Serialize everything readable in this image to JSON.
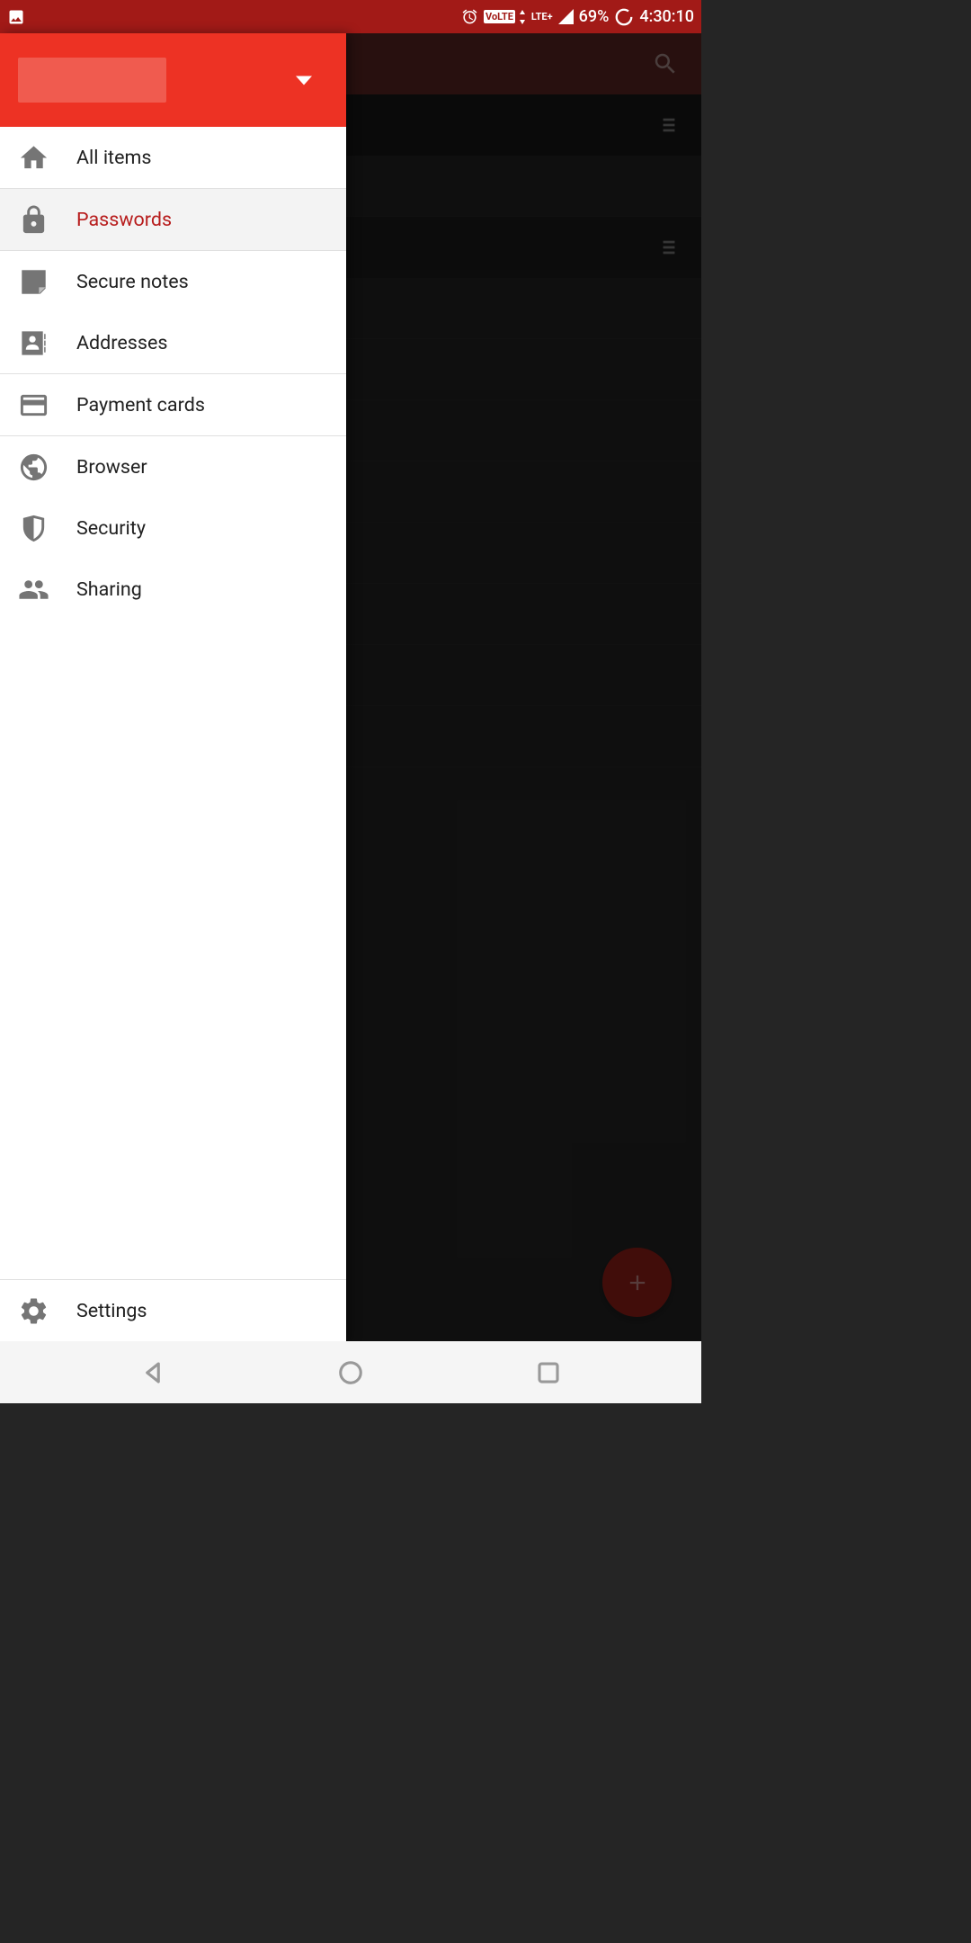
{
  "status_bar": {
    "volte": "VoLTE",
    "lte": "LTE+",
    "battery": "69%",
    "time": "4:30:10"
  },
  "drawer": {
    "items": [
      {
        "label": "All items"
      },
      {
        "label": "Passwords"
      },
      {
        "label": "Secure notes"
      },
      {
        "label": "Addresses"
      },
      {
        "label": "Payment cards"
      },
      {
        "label": "Browser"
      },
      {
        "label": "Security"
      },
      {
        "label": "Sharing"
      }
    ],
    "footer": {
      "label": "Settings"
    }
  },
  "colors": {
    "primary": "#ed3224",
    "primary_dark": "#a21a17",
    "accent": "#b71c1c"
  }
}
